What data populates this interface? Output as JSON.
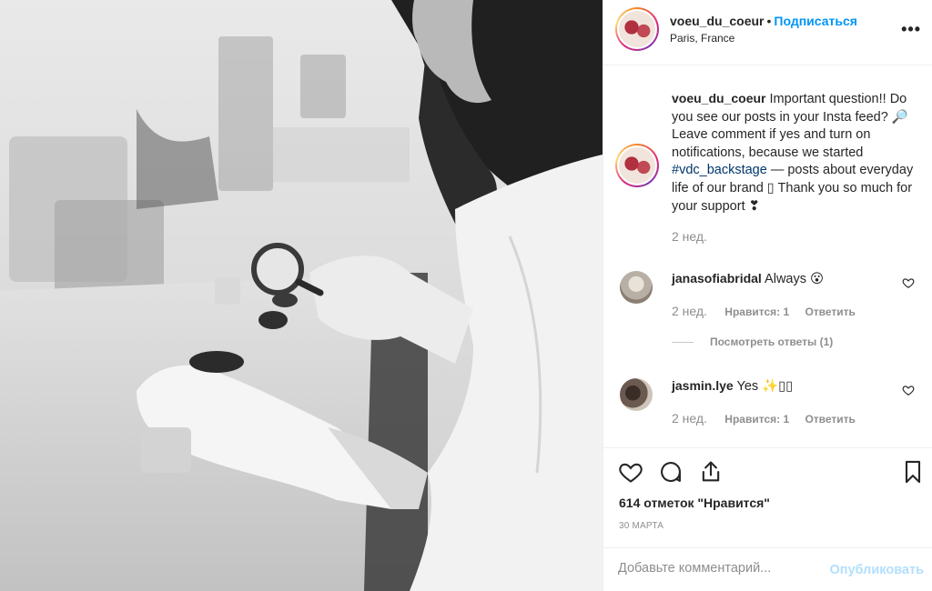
{
  "post": {
    "header": {
      "username": "voeu_du_coeur",
      "separator": "•",
      "follow_label": "Подписаться",
      "location": "Paris, France",
      "more_icon": "more-horizontal-icon"
    },
    "caption": {
      "username": "voeu_du_coeur",
      "text_before_tag": "Important question!! Do you see our posts in your Insta feed? 🔎 Leave comment if yes and turn on notifications, because we started ",
      "hashtag": "#vdc_backstage",
      "text_after_tag": " — posts about everyday life of our brand ▯ Thank you so much for your support ❣",
      "time": "2 нед."
    },
    "comments": [
      {
        "username": "janasofiabridal",
        "text": "Always 😮",
        "time": "2 нед.",
        "likes": "Нравится: 1",
        "reply": "Ответить"
      },
      {
        "username": "jasmin.lye",
        "text": "Yes ✨▯▯",
        "time": "2 нед.",
        "likes": "Нравится: 1",
        "reply": "Ответить"
      }
    ],
    "view_replies": "Посмотреть ответы (1)",
    "likes_count": "614 отметок \"Нравится\"",
    "date": "30 МАРТА",
    "comment_placeholder": "Добавьте комментарий...",
    "publish_label": "Опубликовать"
  },
  "colors": {
    "link_blue": "#0095f6",
    "hashtag": "#00376b",
    "muted": "#8e8e8e",
    "publish_disabled": "#b2dffc"
  }
}
